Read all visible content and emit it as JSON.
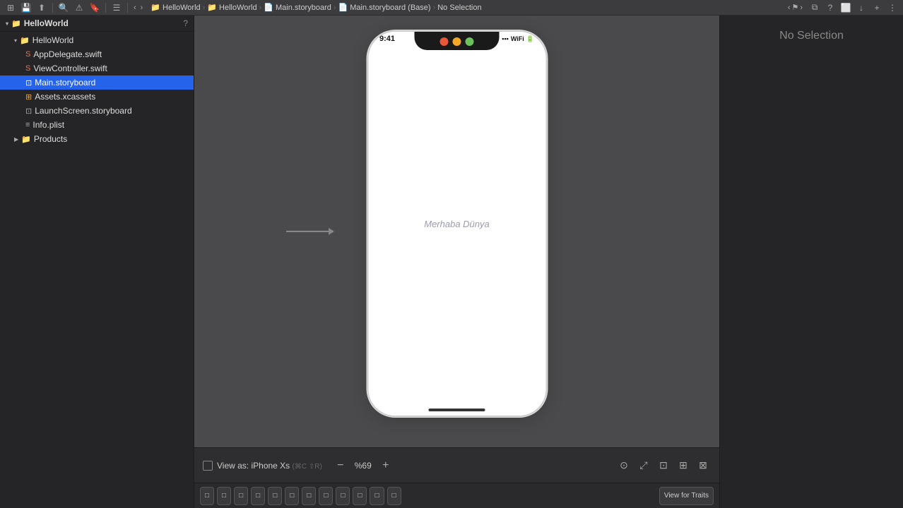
{
  "toolbar": {
    "icons": [
      "square-grid",
      "save",
      "export",
      "search",
      "warning",
      "bookmark",
      "list",
      "back",
      "forward",
      "more"
    ]
  },
  "breadcrumb": {
    "items": [
      "HelloWorld",
      "HelloWorld",
      "Main.storyboard",
      "Main.storyboard (Base)",
      "No Selection"
    ],
    "project_icon": "📁",
    "storyboard_icon": "📄"
  },
  "sidebar": {
    "project_name": "HelloWorld",
    "help_label": "?",
    "files": [
      {
        "name": "HelloWorld",
        "type": "group",
        "indent": 1,
        "expanded": true
      },
      {
        "name": "AppDelegate.swift",
        "type": "swift",
        "indent": 2
      },
      {
        "name": "ViewController.swift",
        "type": "swift",
        "indent": 2
      },
      {
        "name": "Main.storyboard",
        "type": "storyboard",
        "indent": 2,
        "selected": true
      },
      {
        "name": "Assets.xcassets",
        "type": "assets",
        "indent": 2
      },
      {
        "name": "LaunchScreen.storyboard",
        "type": "storyboard",
        "indent": 2
      },
      {
        "name": "Info.plist",
        "type": "plist",
        "indent": 2
      },
      {
        "name": "Products",
        "type": "group",
        "indent": 1,
        "expanded": false
      }
    ]
  },
  "canvas": {
    "hello_label": "Merhaba Dünya",
    "status_time": "9:41"
  },
  "bottom_bar": {
    "view_as_label": "View as: iPhone Xs",
    "shortcut": "(⌘C ⇧R)",
    "zoom_minus": "−",
    "zoom_pct": "%69",
    "zoom_plus": "+"
  },
  "right_panel": {
    "no_selection": "No Selection"
  },
  "device_buttons": [
    "□",
    "□",
    "□",
    "□",
    "□",
    "□",
    "□",
    "□",
    "□",
    "□",
    "□",
    "□"
  ]
}
